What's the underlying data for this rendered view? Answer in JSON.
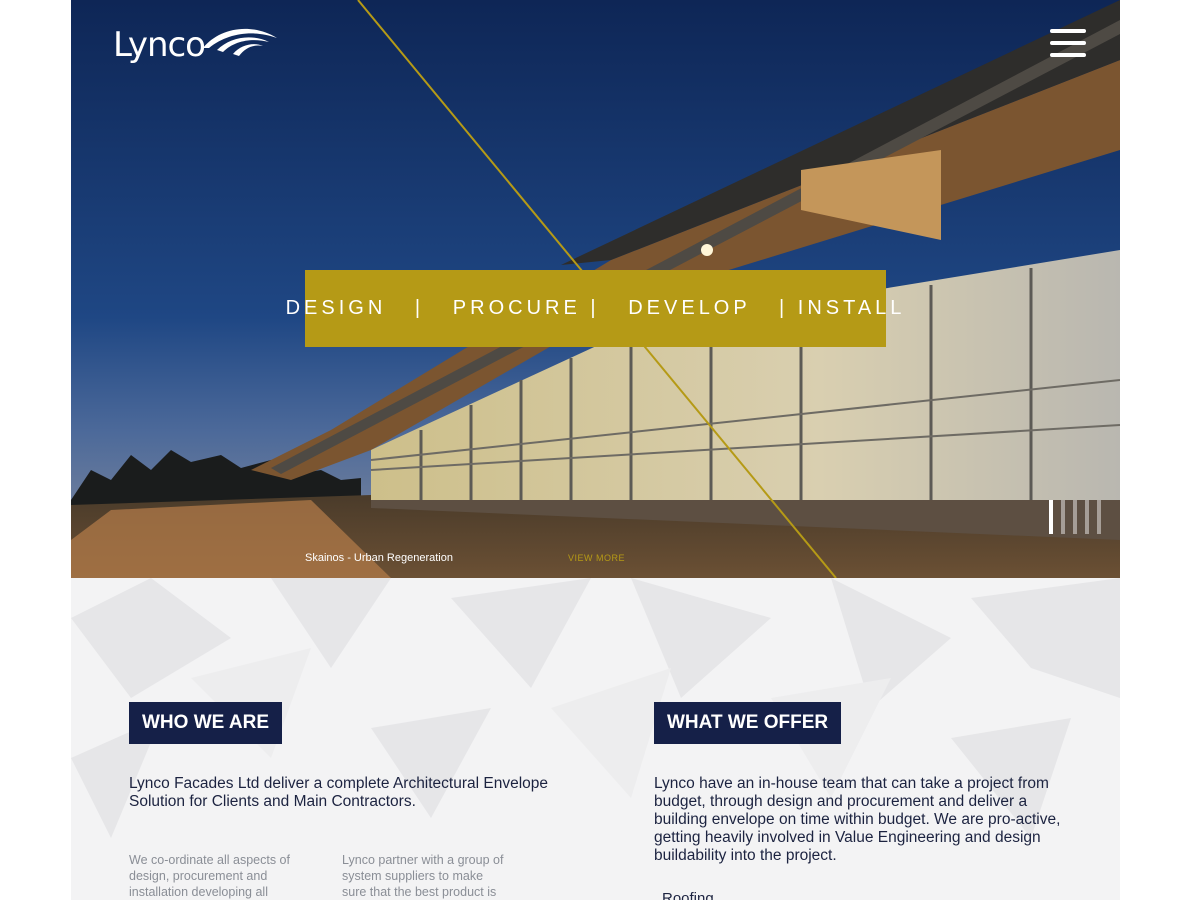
{
  "header": {
    "logo_text": "Lynco",
    "menu_icon": "hamburger-menu-icon"
  },
  "hero": {
    "tagline": "DESIGN   |   PROCURE |   DEVELOP   | INSTALL",
    "caption": "Skainos - Urban Regeneration",
    "view_more": "VIEW MORE",
    "accent_color": "#b59a16",
    "slides_count": 5,
    "active_slide": 1
  },
  "who_we_are": {
    "heading": "WHO WE ARE",
    "lead": "Lynco Facades Ltd deliver a complete Architectural Envelope Solution for Clients and Main Contractors.",
    "col1": "We co-ordinate all aspects of design, procurement and installation developing all",
    "col2": "Lynco partner with a group of system suppliers to make sure that the best product is selected"
  },
  "what_we_offer": {
    "heading": "WHAT WE OFFER",
    "lead": "Lynco have an in-house team that can take a project from budget, through design and procurement and deliver a building envelope on time within budget. We are pro-active, getting heavily involved in Value Engineering and design buildability into the project.",
    "first_item": "Roofing"
  },
  "colors": {
    "navy": "#152048",
    "gold": "#b59a16"
  }
}
